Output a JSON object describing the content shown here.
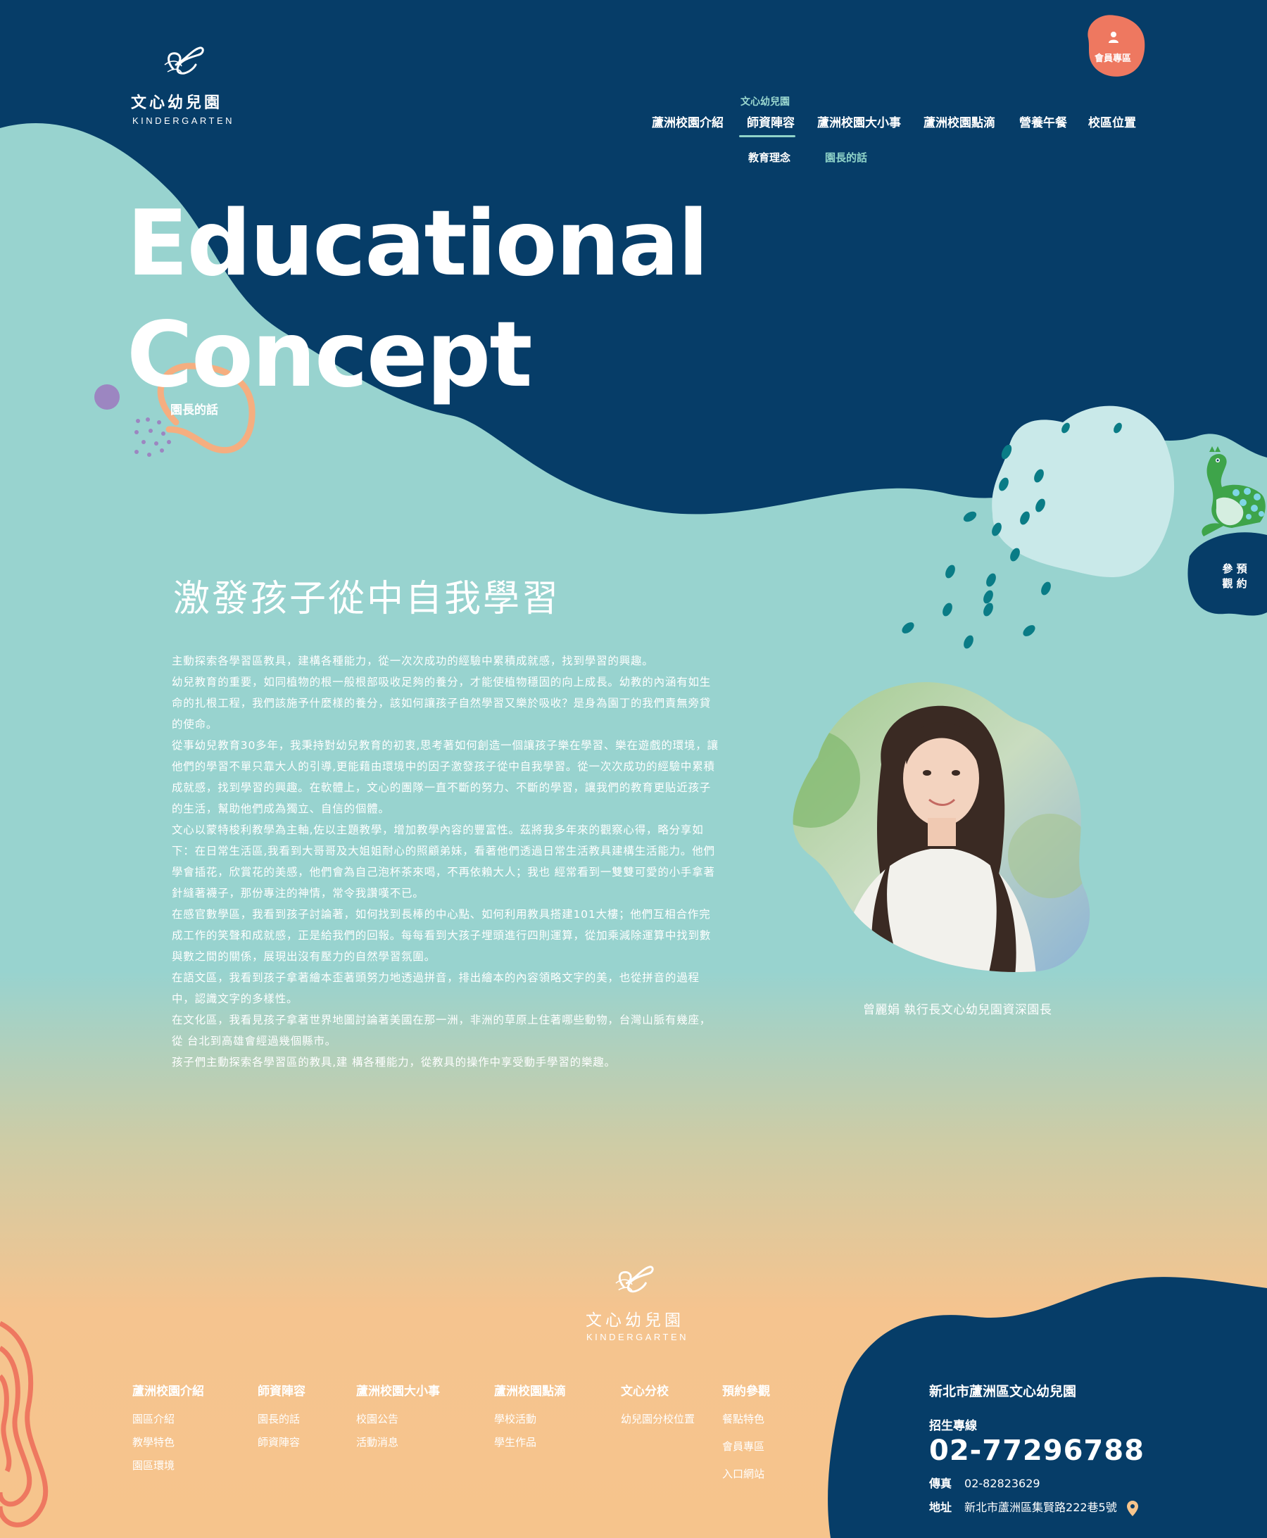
{
  "header": {
    "logo_zh": "文心幼兒園",
    "logo_en": "KINDERGARTEN",
    "member_label": "會員專區",
    "nav": [
      {
        "label": "蘆洲校園介紹"
      },
      {
        "label": "師資陣容"
      },
      {
        "label": "蘆洲校園大小事"
      },
      {
        "label": "蘆洲校園點滴"
      },
      {
        "label": "營養午餐"
      },
      {
        "label": "校區位置"
      }
    ],
    "nav_active_sub_label": "文心幼兒園",
    "subnav": [
      {
        "label": "教育理念"
      },
      {
        "label": "園長的話"
      }
    ]
  },
  "hero": {
    "title_line1": "Educational",
    "title_line2": "Concept",
    "badge": "園長的話",
    "side_button": "參預\n觀約"
  },
  "content": {
    "section_title": "激發孩子從中自我學習",
    "paragraphs": [
      "主動探索各學習區教具，建構各種能力，從一次次成功的經驗中累積成就感，找到學習的興趣。",
      "幼兒教育的重要，如同植物的根一般根部吸收足夠的養分，才能使植物穩固的向上成長。幼教的內涵有如生命的扎根工程，我們該施予什麼樣的養分，該如何讓孩子自然學習又樂於吸收？是身為園丁的我們責無旁貸的使命。",
      "從事幼兒教育30多年，我秉持對幼兒教育的初衷,思考著如何創造一個讓孩子樂在學習、樂在遊戲的環境，讓他們的學習不單只靠大人的引導,更能藉由環境中的因子激發孩子從中自我學習。從一次次成功的經驗中累積成就感，找到學習的興趣。在軟體上，文心的團隊一直不斷的努力、不斷的學習，讓我們的教育更貼近孩子的生活，幫助他們成為獨立、自信的個體。",
      "文心以蒙特梭利教學為主軸,佐以主題教學，增加教學內容的豐富性。茲將我多年來的觀察心得，略分享如下：在日常生活區,我看到大哥哥及大姐姐耐心的照顧弟妹，看著他們透過日常生活教具建構生活能力。他們學會插花，欣賞花的美感，他們會為自己泡杯茶來喝，不再依賴大人；我也 經常看到一雙雙可愛的小手拿著針縫著襪子，那份專注的神情，常令我讚嘆不已。",
      "在感官數學區，我看到孩子討論著，如何找到長棒的中心點、如何利用教具搭建101大樓；他們互相合作完成工作的笑聲和成就感，正是給我們的回報。每每看到大孩子埋頭進行四則運算，從加乘減除運算中找到數與數之間的關係，展現出沒有壓力的自然學習氛圍。",
      "在語文區，我看到孩子拿著繪本歪著頭努力地透過拼音，排出繪本的內容領略文字的美，也從拼音的過程中，認識文字的多樣性。",
      "在文化區，我看見孩子拿著世界地圖討論著美國在那一洲，非洲的草原上住著哪些動物，台灣山脈有幾座，從 台北到高雄會經過幾個縣市。",
      "孩子們主動探索各學習區的教具,建 構各種能力，從教具的操作中享受動手學習的樂趣。"
    ],
    "photo_caption": "曾麗娟 執行長文心幼兒園資深園長"
  },
  "footer": {
    "logo_zh": "文心幼兒園",
    "logo_en": "KINDERGARTEN",
    "columns": [
      {
        "heading": "蘆洲校園介紹",
        "items": [
          "園區介紹",
          "教學特色",
          "園區環境"
        ]
      },
      {
        "heading": "師資陣容",
        "items": [
          "園長的話",
          "師資陣容"
        ]
      },
      {
        "heading": "蘆洲校園大小事",
        "items": [
          "校園公告",
          "活動消息"
        ]
      },
      {
        "heading": "蘆洲校園點滴",
        "items": [
          "學校活動",
          "學生作品"
        ]
      },
      {
        "heading": "文心分校",
        "items": [
          "幼兒園分校位置"
        ]
      },
      {
        "heading": "預約參觀",
        "items": [
          "餐點特色",
          "會員專區",
          "入口網站"
        ]
      }
    ],
    "contact": {
      "name": "新北市蘆洲區文心幼兒園",
      "hotline_label": "招生專線",
      "hotline": "02-77296788",
      "fax_label": "傳真",
      "fax": "02-82823629",
      "address_label": "地址",
      "address": "新北市蘆洲區集賢路222巷5號"
    }
  },
  "colors": {
    "navy": "#063d68",
    "mint": "#98d3cf",
    "coral": "#ee7860",
    "peach": "#f6c48c",
    "orange_stroke": "#f5ae80",
    "purple": "#9c86c1"
  },
  "icons": [
    "logo-mark",
    "user-icon",
    "dinosaur-icon",
    "location-pin-icon"
  ]
}
